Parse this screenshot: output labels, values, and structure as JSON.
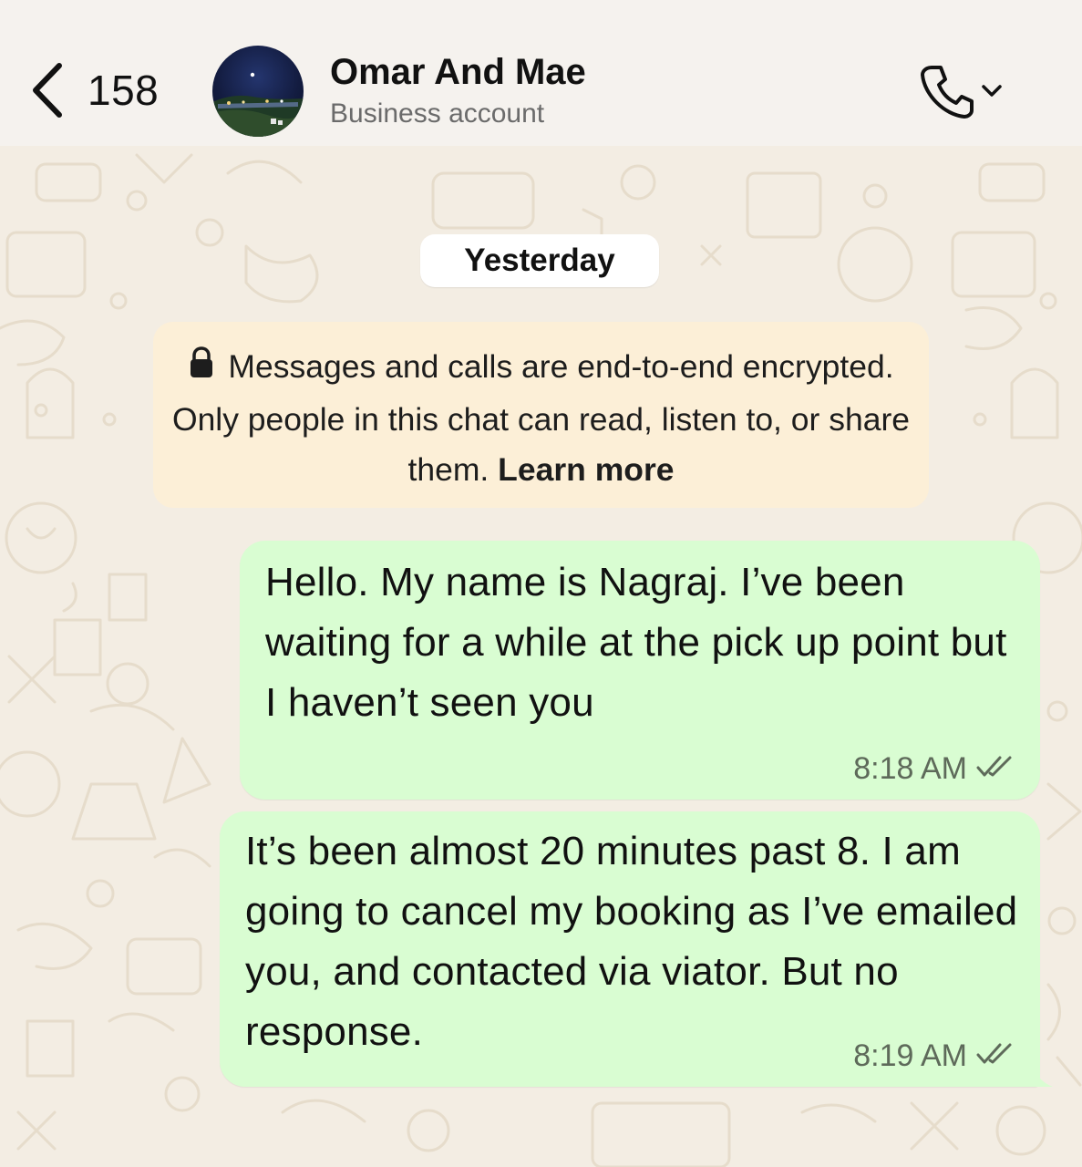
{
  "header": {
    "back_count": "158",
    "contact_name": "Omar And Mae",
    "contact_subtitle": "Business account",
    "icons": {
      "back": "chevron-left-icon",
      "call": "phone-icon",
      "call_menu": "chevron-down-icon"
    }
  },
  "chat": {
    "date_separator": "Yesterday",
    "encryption_notice": {
      "text": "Messages and calls are end-to-end encrypted. Only people in this chat can read, listen to, or share them.",
      "link_label": "Learn more",
      "icon": "lock-icon"
    },
    "messages": [
      {
        "direction": "outgoing",
        "text": "Hello. My name is Nagraj. I’ve been waiting for a while at the pick up point but I haven’t seen you",
        "time": "8:18 AM",
        "status": "read"
      },
      {
        "direction": "outgoing",
        "text": "It’s been almost 20 minutes past 8. I am going to cancel my booking as I’ve emailed you, and contacted via viator. But no response.",
        "time": "8:19 AM",
        "status": "read"
      }
    ]
  },
  "colors": {
    "header_bg": "#f5f2ee",
    "chat_bg": "#f3ede3",
    "outgoing_bubble": "#d9fdd2",
    "notice_bg": "#fcefd7",
    "read_ticks": "#5e6a5a"
  }
}
